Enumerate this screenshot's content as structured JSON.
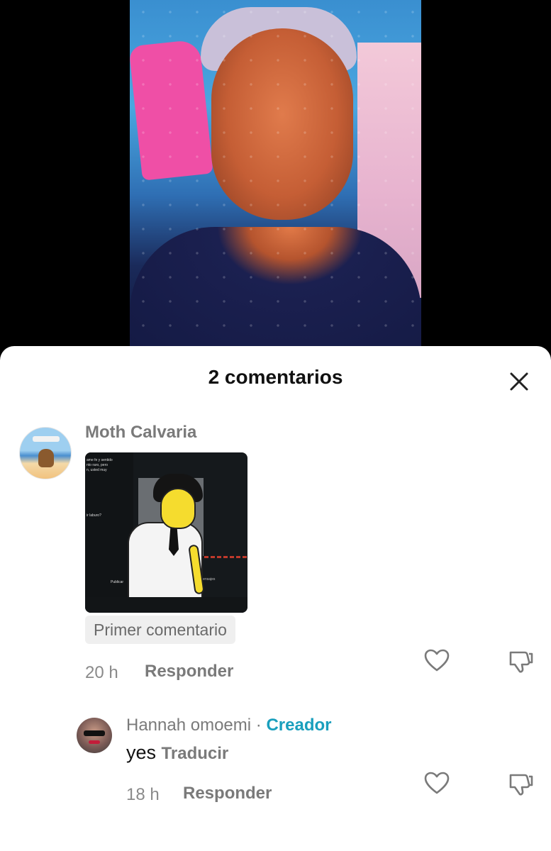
{
  "comments_sheet": {
    "title": "2 comentarios",
    "close_icon": "close-icon"
  },
  "comments": [
    {
      "author": "Moth Calvaria",
      "pinned_label": "Primer comentario",
      "time": "20 h",
      "reply_label": "Responder",
      "has_image": true,
      "image_texts": [
        "ame fe y sentido",
        "nto raro, pero",
        "n, usted muy",
        "ir laburo?",
        "Publicar",
        "Mensajes"
      ]
    },
    {
      "author": "Hannah omoemi",
      "separator": "·",
      "creator_tag": "Creador",
      "text": "yes",
      "translate_label": "Traducir",
      "time": "18 h",
      "reply_label": "Responder"
    }
  ],
  "icons": {
    "like": "heart-outline-icon",
    "dislike": "thumbs-down-outline-icon",
    "close": "close-icon"
  },
  "colors": {
    "creator_accent": "#1a9fbd",
    "secondary_text": "#7a7a7a",
    "sheet_background": "#ffffff"
  }
}
